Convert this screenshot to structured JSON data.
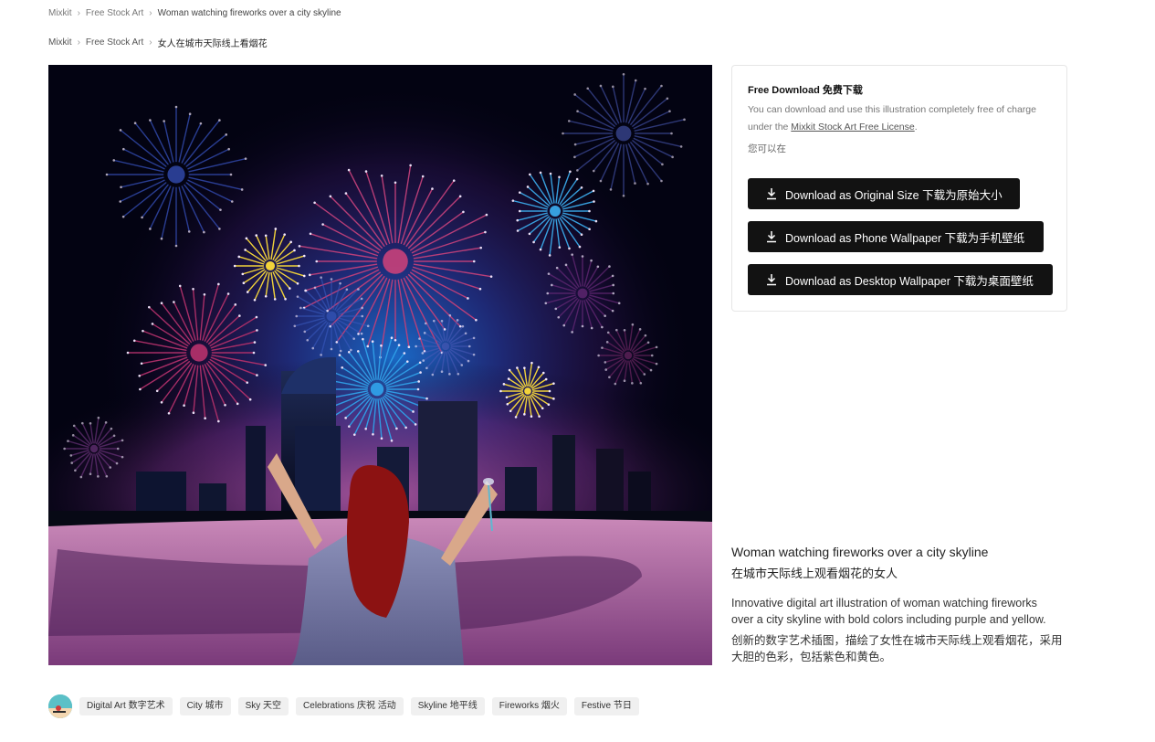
{
  "breadcrumb_top": {
    "root": "Mixkit",
    "section": "Free Stock Art",
    "current": "Woman watching fireworks over a city skyline"
  },
  "breadcrumb_main": {
    "root": "Mixkit",
    "section": "Free Stock Art",
    "current": "女人在城市天际线上看烟花"
  },
  "artwork": {
    "description_icon": "fireworks-illustration",
    "colors": {
      "sky_dark": "#030312",
      "sky_glow": "#1b6fd0",
      "purple": "#6b2a7a",
      "pink_water": "#c988b8",
      "yellow": "#f2d33a",
      "hair": "#8c1212"
    }
  },
  "download_card": {
    "title": "Free Download 免费下载",
    "desc_prefix": "You can download and use this illustration completely free of charge under the ",
    "license_link": "Mixkit Stock Art Free License",
    "desc_suffix": ".",
    "note": "您可以在",
    "buttons": {
      "original": "Download as Original Size 下载为原始大小",
      "phone": "Download as Phone Wallpaper 下载为手机壁纸",
      "desktop": "Download as Desktop Wallpaper 下载为桌面壁纸"
    },
    "button_icon": "download-icon"
  },
  "info": {
    "title": "Woman watching fireworks over a city skyline",
    "title_cn": "在城市天际线上观看烟花的女人",
    "description": "Innovative digital art illustration of woman watching fireworks over a city skyline with bold colors including purple and yellow.",
    "description_cn": "创新的数字艺术插图，描绘了女性在城市天际线上观看烟花，采用大胆的色彩，包括紫色和黄色。"
  },
  "tags": [
    "Digital Art 数字艺术",
    "City 城市",
    "Sky 天空",
    "Celebrations 庆祝 活动",
    "Skyline 地平线",
    "Fireworks 烟火",
    "Festive 节日"
  ]
}
